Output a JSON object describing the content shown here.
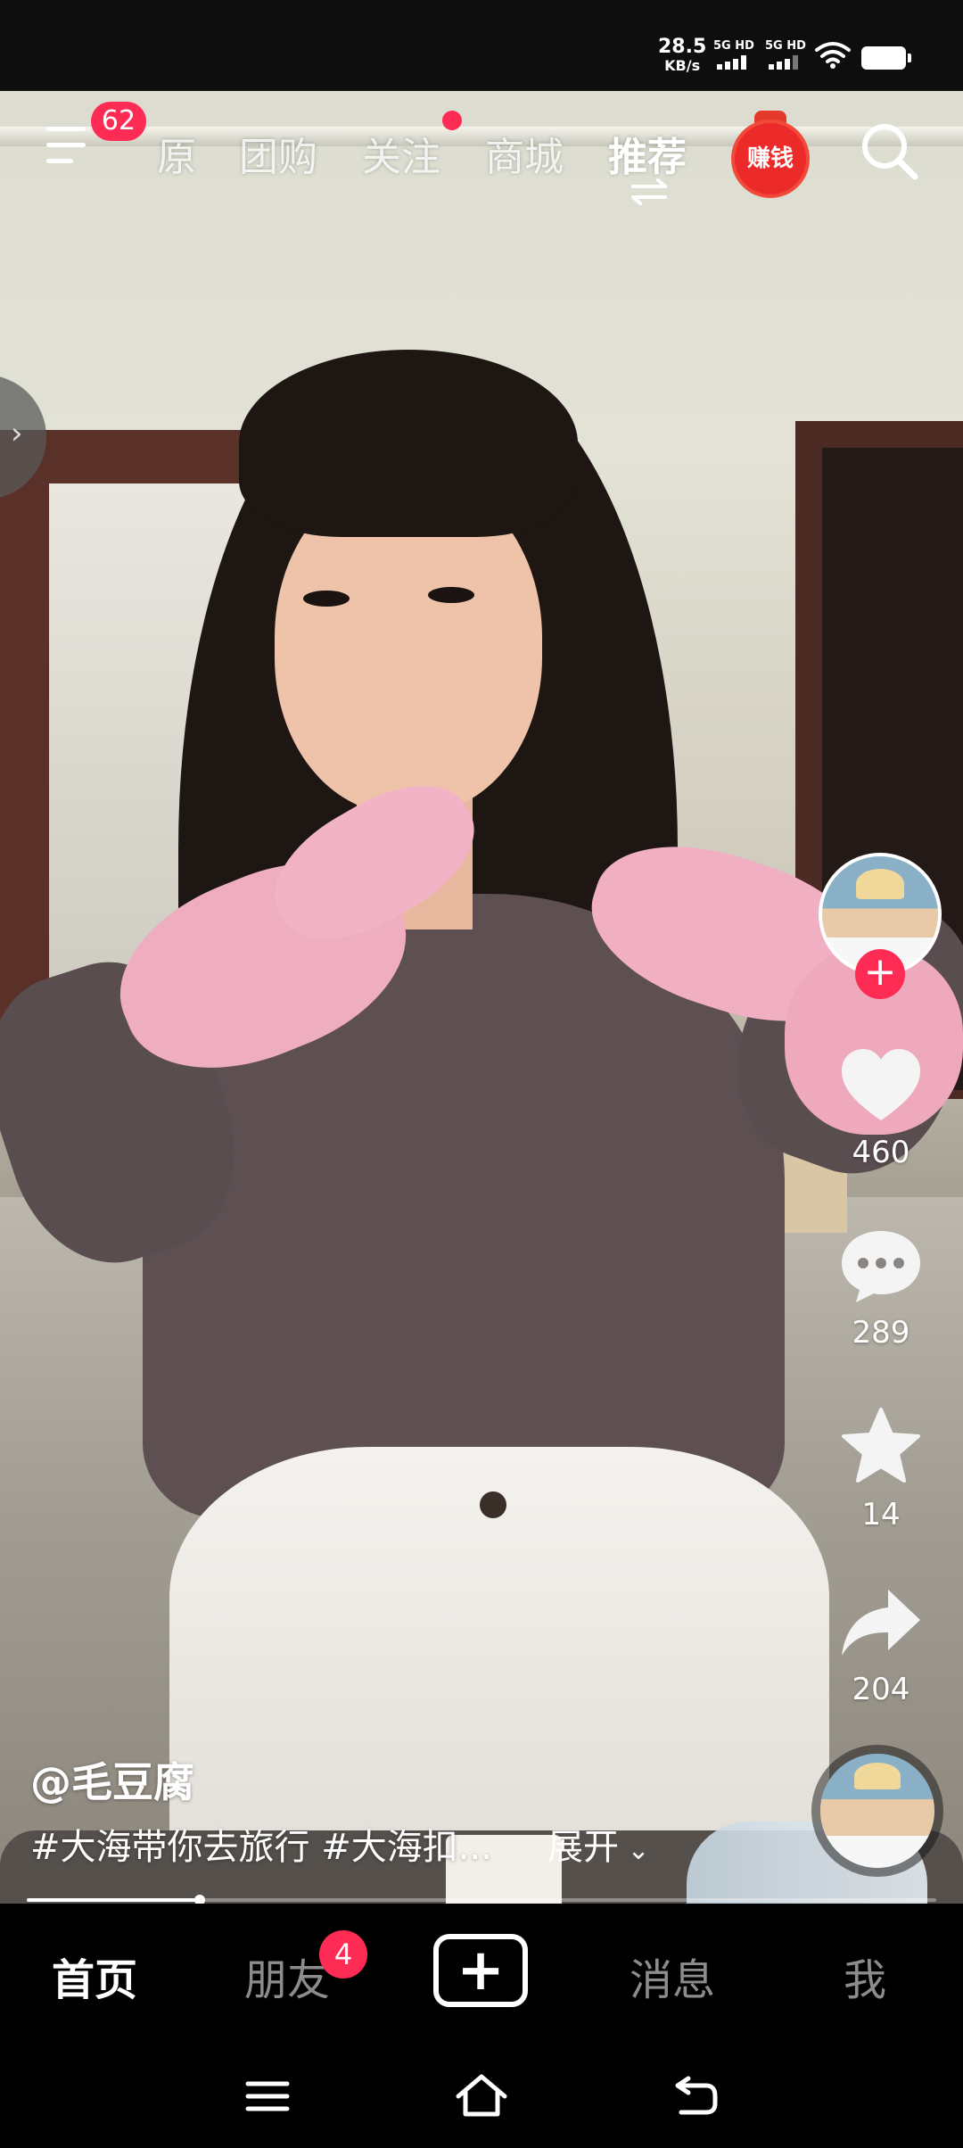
{
  "status_bar": {
    "net_speed_value": "28.5",
    "net_speed_unit": "KB/s",
    "sim1_label": "5G HD",
    "sim2_label": "5G HD",
    "icons": [
      "signal-icon",
      "wifi-icon",
      "battery-icon"
    ]
  },
  "top_nav": {
    "menu_badge": "62",
    "tabs": [
      {
        "label": "原",
        "active": false
      },
      {
        "label": "团购",
        "active": false
      },
      {
        "label": "关注",
        "active": false,
        "dot": true
      },
      {
        "label": "商城",
        "active": false
      },
      {
        "label": "推荐",
        "active": true
      }
    ],
    "earn_label": "赚钱",
    "accent_color": "#fe2c55"
  },
  "video": {
    "author": "@毛豆腐",
    "caption": "#大海带你去旅行 #大海扣...",
    "expand_label": "展开",
    "progress": 0.19
  },
  "actions": {
    "likes": "460",
    "comments": "289",
    "favorites": "14",
    "shares": "204",
    "follow_plus": "+"
  },
  "bottom_tabs": [
    {
      "label": "首页",
      "active": true
    },
    {
      "label": "朋友",
      "active": false,
      "badge": "4"
    },
    {
      "label": "+",
      "active": false
    },
    {
      "label": "消息",
      "active": false
    },
    {
      "label": "我",
      "active": false
    }
  ]
}
